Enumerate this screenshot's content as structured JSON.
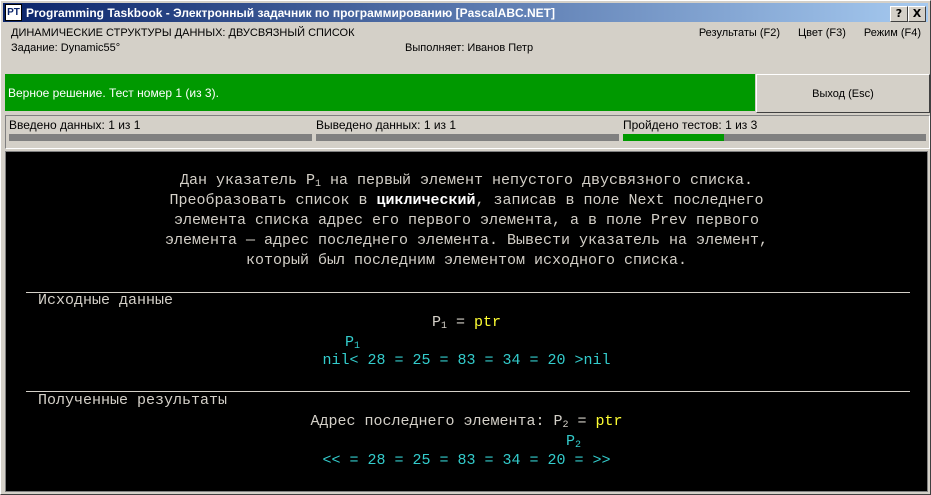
{
  "window": {
    "title": "Programming Taskbook - Электронный задачник по программированию [PascalABC.NET]",
    "help_button": "?",
    "close_button": "X",
    "app_icon": "PT"
  },
  "header": {
    "topic": "ДИНАМИЧЕСКИЕ СТРУКТУРЫ ДАННЫХ: ДВУСВЯЗНЫЙ СПИСОК",
    "task": "Задание: Dynamic55°",
    "performer": "Выполняет: Иванов Петр",
    "menu": [
      "Результаты (F2)",
      "Цвет (F3)",
      "Режим (F4)"
    ]
  },
  "status": {
    "message": "Верное решение. Тест номер 1 (из 3).",
    "exit_label": "Выход (Esc)",
    "color": "#009900"
  },
  "counters": [
    {
      "label": "Введено данных: 1 из 1",
      "progress": 0
    },
    {
      "label": "Выведено данных: 1 из 1",
      "progress": 0
    },
    {
      "label": "Пройдено тестов: 1 из 3",
      "progress": 0.333
    }
  ],
  "task_text": {
    "l1_a": "Дан указатель P",
    "l1_sub": "1",
    "l1_b": " на первый элемент непустого двусвязного списка.",
    "l2_a": "Преобразовать список в ",
    "l2_bold": "циклический",
    "l2_b": ", записав в поле Next последнего",
    "l3": "элемента списка адрес его первого элемента, а в поле Prev первого",
    "l4": "элемента — адрес последнего элемента. Вывести указатель на элемент,",
    "l5": "который был последним элементом исходного списка."
  },
  "input_section": {
    "heading": "Исходные данные",
    "p_label": "P",
    "p_sub": "1",
    "p_eq": " = ",
    "p_val": "ptr",
    "marker": "P",
    "marker_sub": "1",
    "list": "nil< 28 = 25 = 83 = 34 = 20 >nil"
  },
  "output_section": {
    "heading": "Полученные результаты",
    "desc": "Адрес последнего элемента: P",
    "desc_sub": "2",
    "eq": " = ",
    "val": "ptr",
    "marker": "P",
    "marker_sub": "2",
    "list": "<< = 28 = 25 = 83 = 34 = 20 = >>"
  }
}
